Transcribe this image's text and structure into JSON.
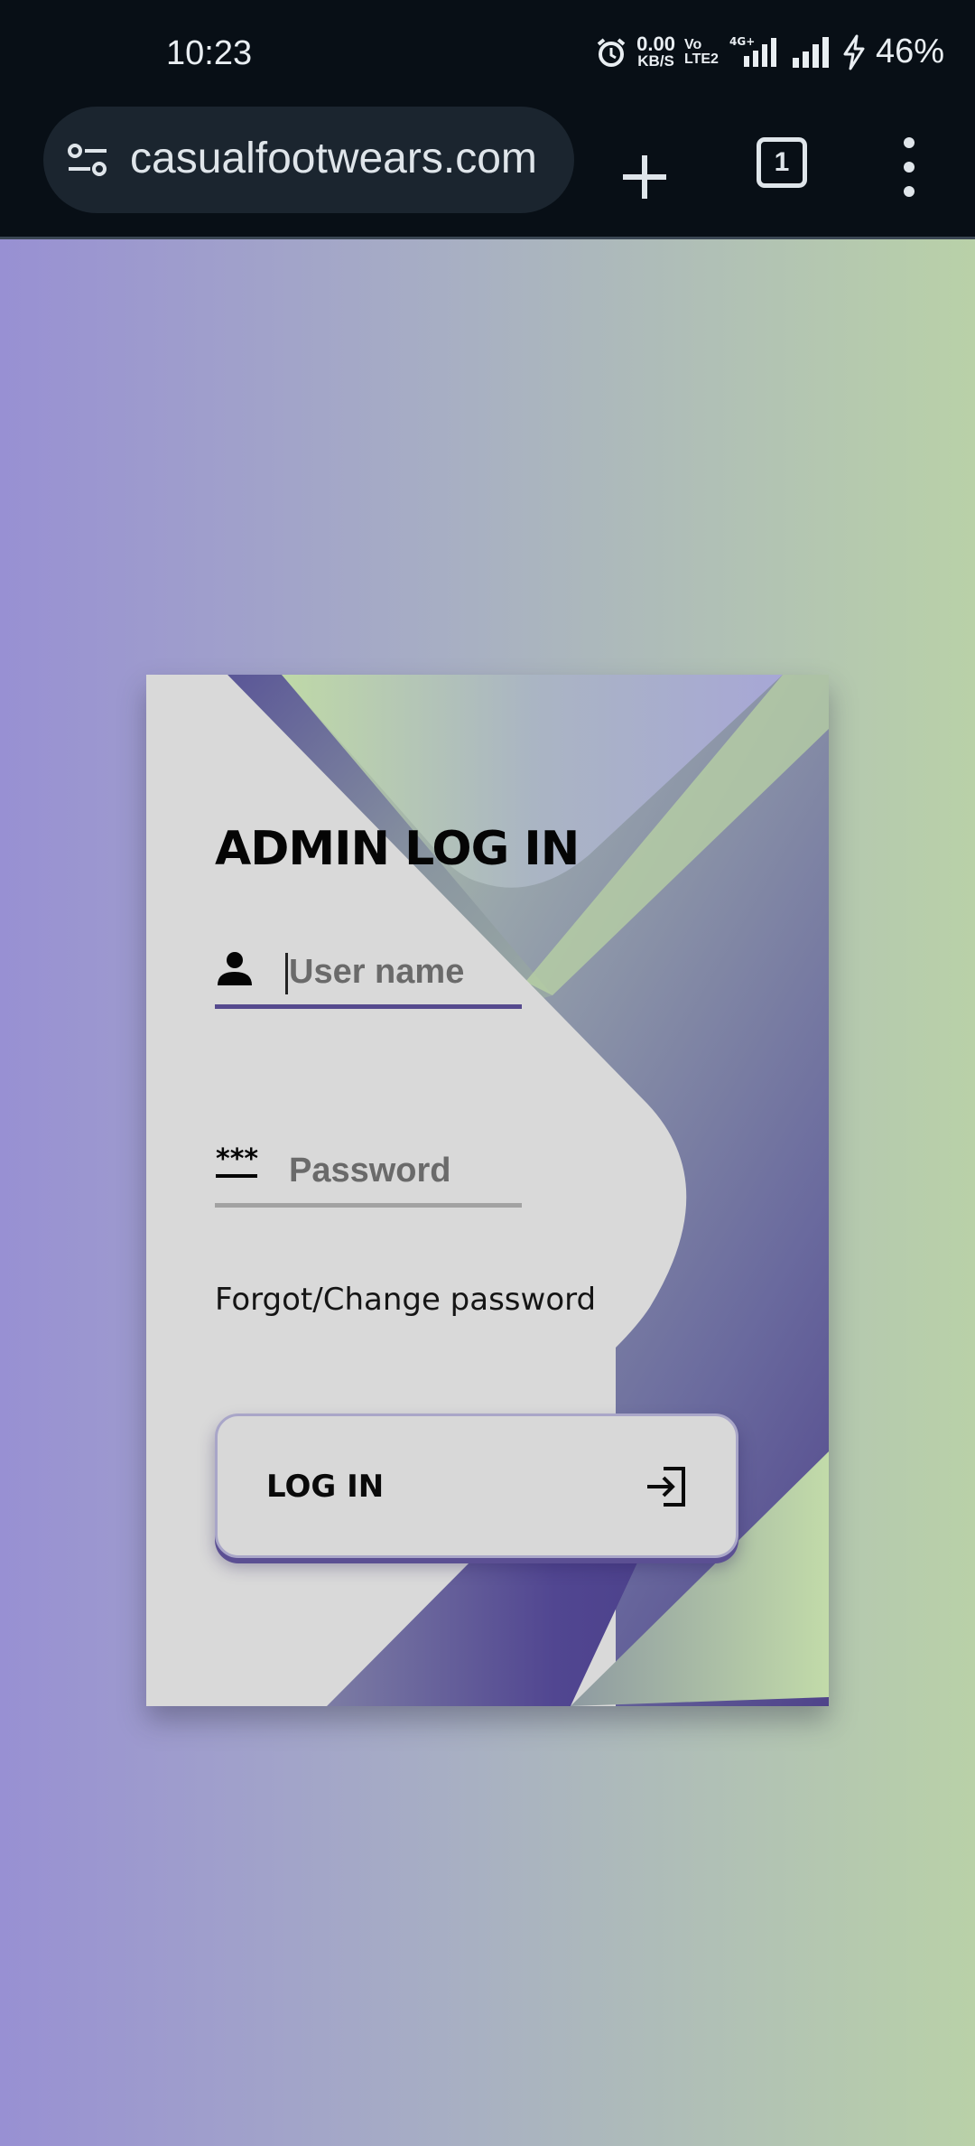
{
  "status_bar": {
    "time": "10:23",
    "net_speed_value": "0.00",
    "net_speed_unit": "KB/S",
    "volte_top": "Vo",
    "volte_bottom": "LTE2",
    "network_type": "4G+",
    "battery": "46%"
  },
  "browser": {
    "url": "casualfootwears.com",
    "tab_count": "1"
  },
  "login": {
    "title": "ADMIN LOG IN",
    "username_placeholder": "User name",
    "password_placeholder": "Password",
    "password_icon_text": "***",
    "forgot_link": "Forgot/Change password",
    "login_button": "LOG IN"
  },
  "colors": {
    "accent": "#564a8e",
    "green": "#bfd9a7",
    "lavender": "#9890d3"
  }
}
